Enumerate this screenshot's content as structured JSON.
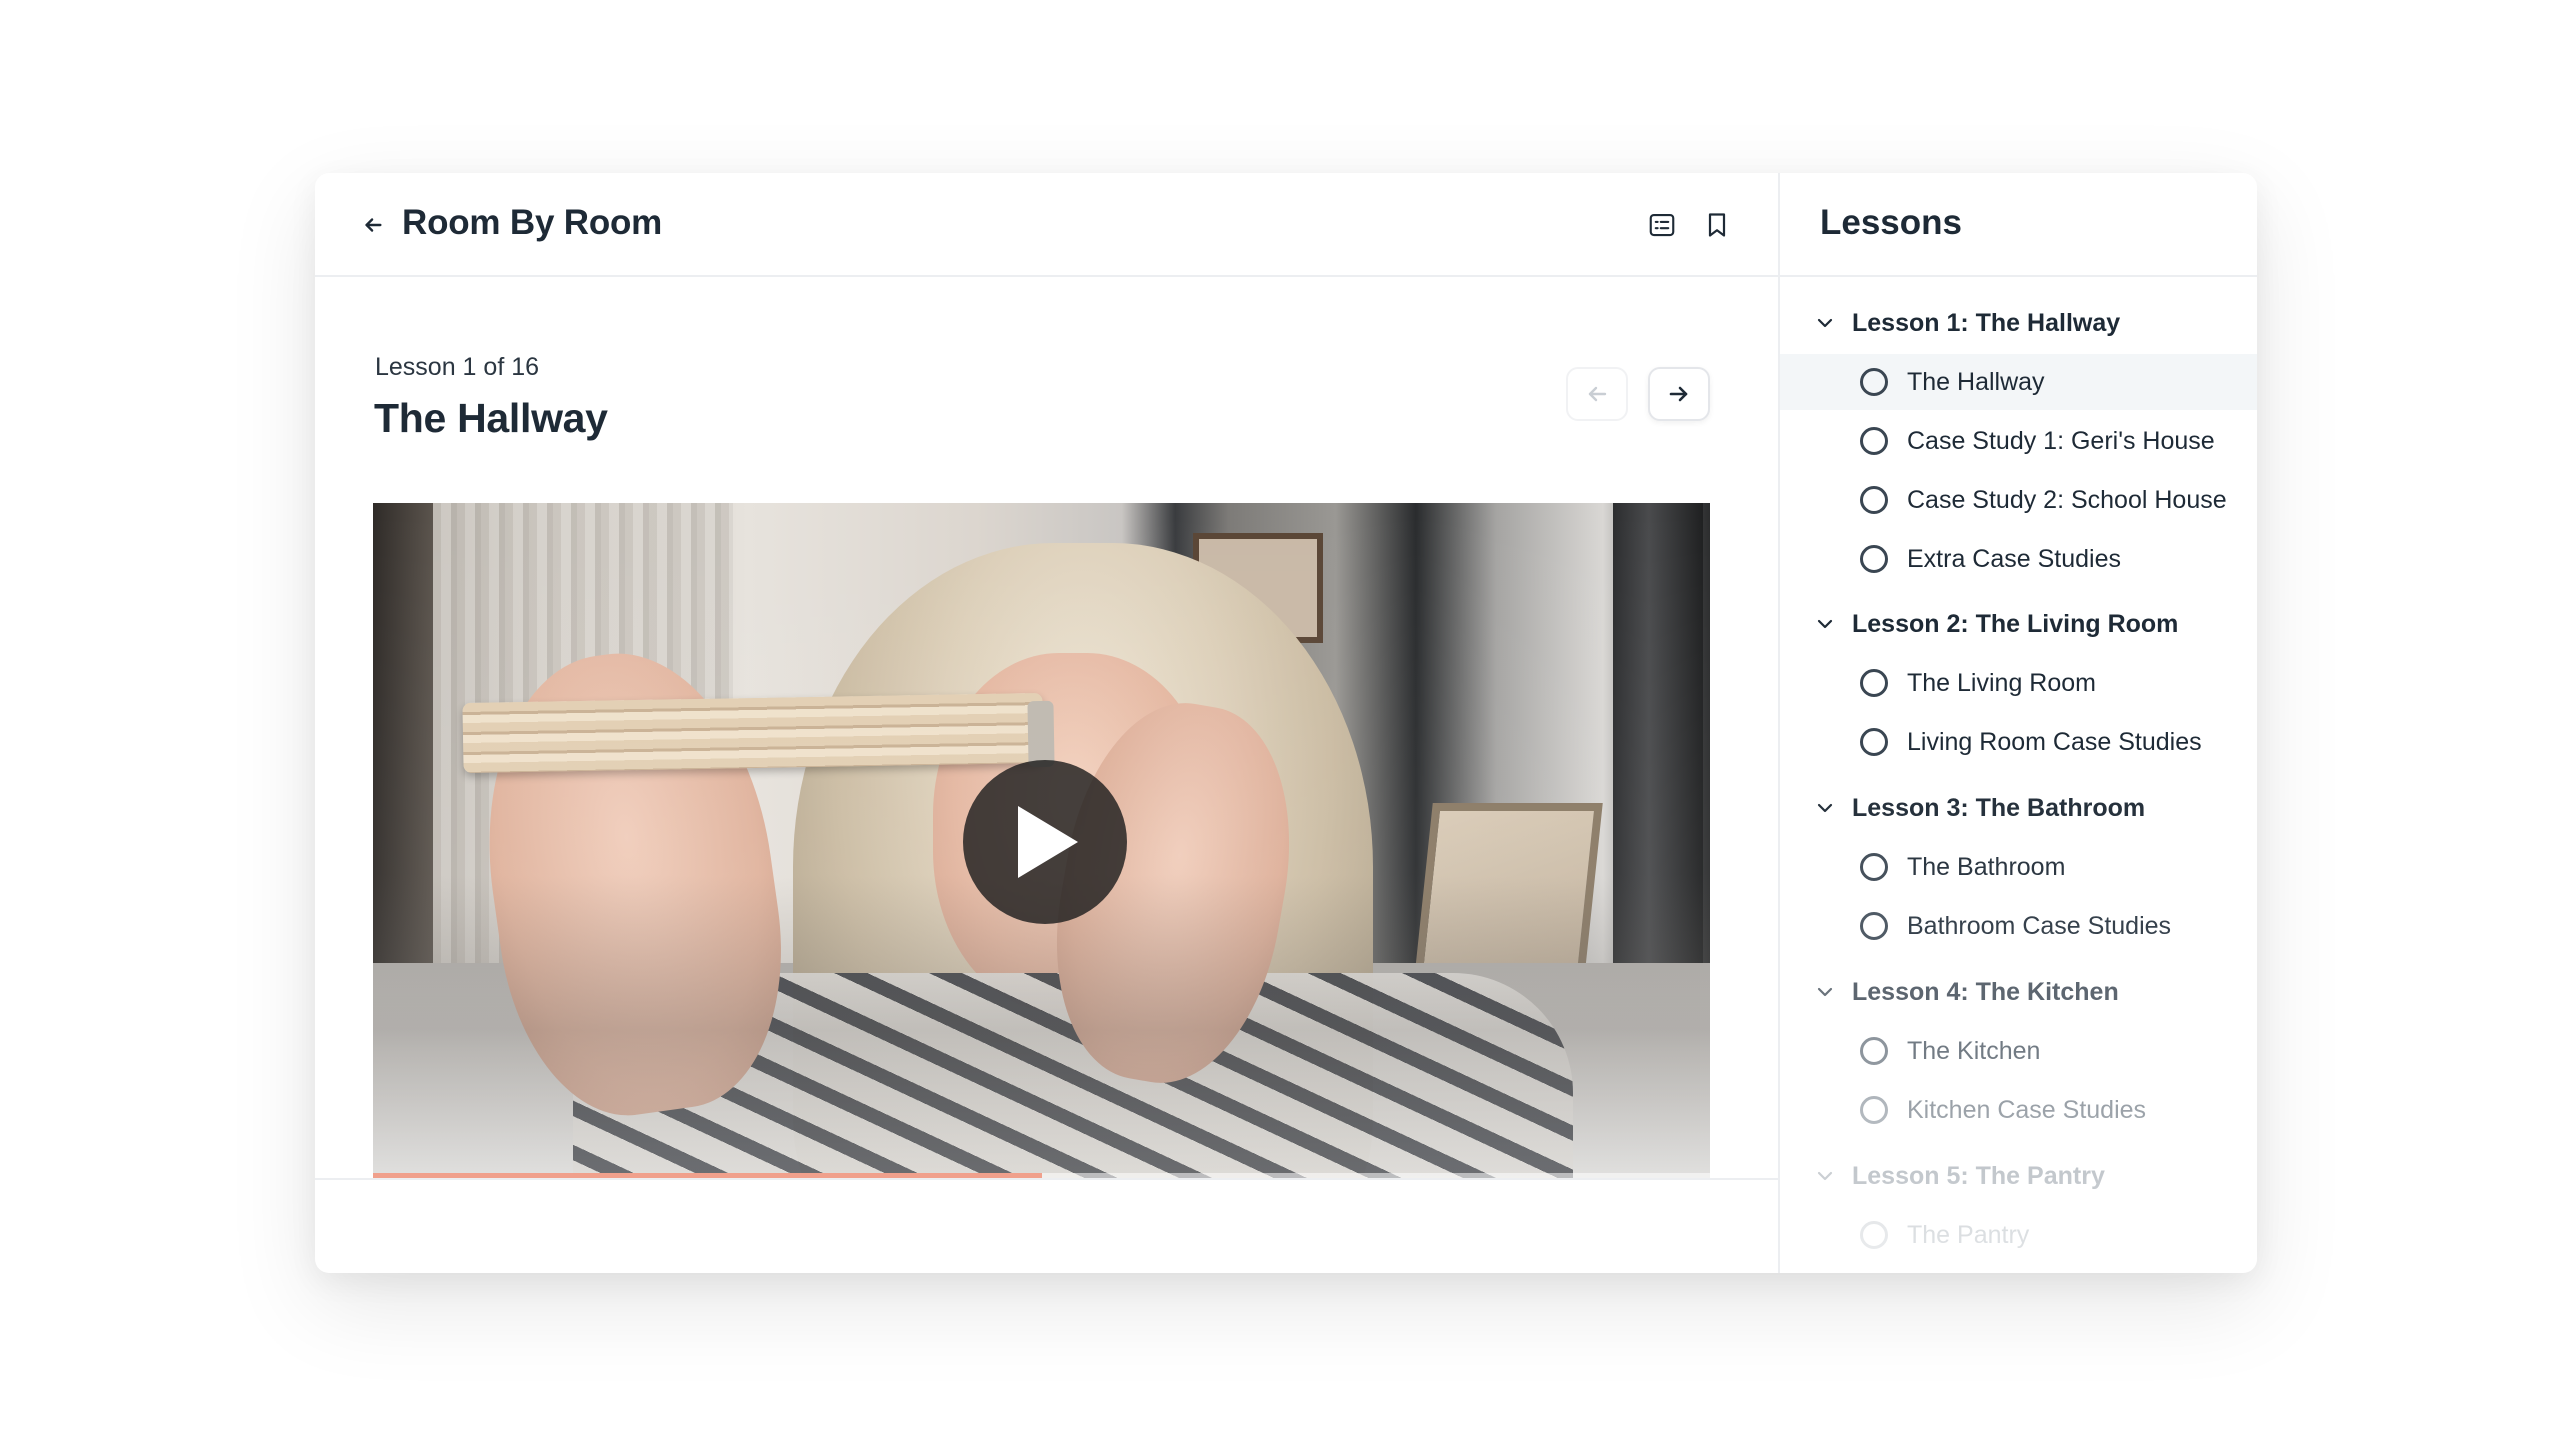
{
  "header": {
    "course_title": "Room By Room",
    "back_icon": "arrow-left-icon",
    "notes_icon": "notes-icon",
    "bookmark_icon": "bookmark-icon"
  },
  "lesson": {
    "counter": "Lesson 1 of 16",
    "title": "The Hallway",
    "prev_icon": "arrow-left-icon",
    "next_icon": "arrow-right-icon"
  },
  "video": {
    "play_icon": "play-icon",
    "progress_fraction": 0.5,
    "progress_color": "#f0a08c"
  },
  "sidebar": {
    "title": "Lessons",
    "sections": [
      {
        "label": "Lesson 1: The Hallway",
        "items": [
          "The Hallway",
          "Case Study 1: Geri's House",
          "Case Study 2: School House",
          "Extra Case Studies"
        ]
      },
      {
        "label": "Lesson 2: The Living Room",
        "items": [
          "The Living Room",
          "Living Room Case Studies"
        ]
      },
      {
        "label": "Lesson 3: The Bathroom",
        "items": [
          "The Bathroom",
          "Bathroom Case Studies"
        ]
      },
      {
        "label": "Lesson 4: The Kitchen",
        "items": [
          "The Kitchen",
          "Kitchen Case Studies"
        ]
      },
      {
        "label": "Lesson 5: The Pantry",
        "items": [
          "The Pantry"
        ]
      }
    ],
    "active_item": "The Hallway"
  },
  "colors": {
    "text_primary": "#1e2a36",
    "active_row_bg": "#f3f6f8",
    "border": "#eceef1"
  }
}
